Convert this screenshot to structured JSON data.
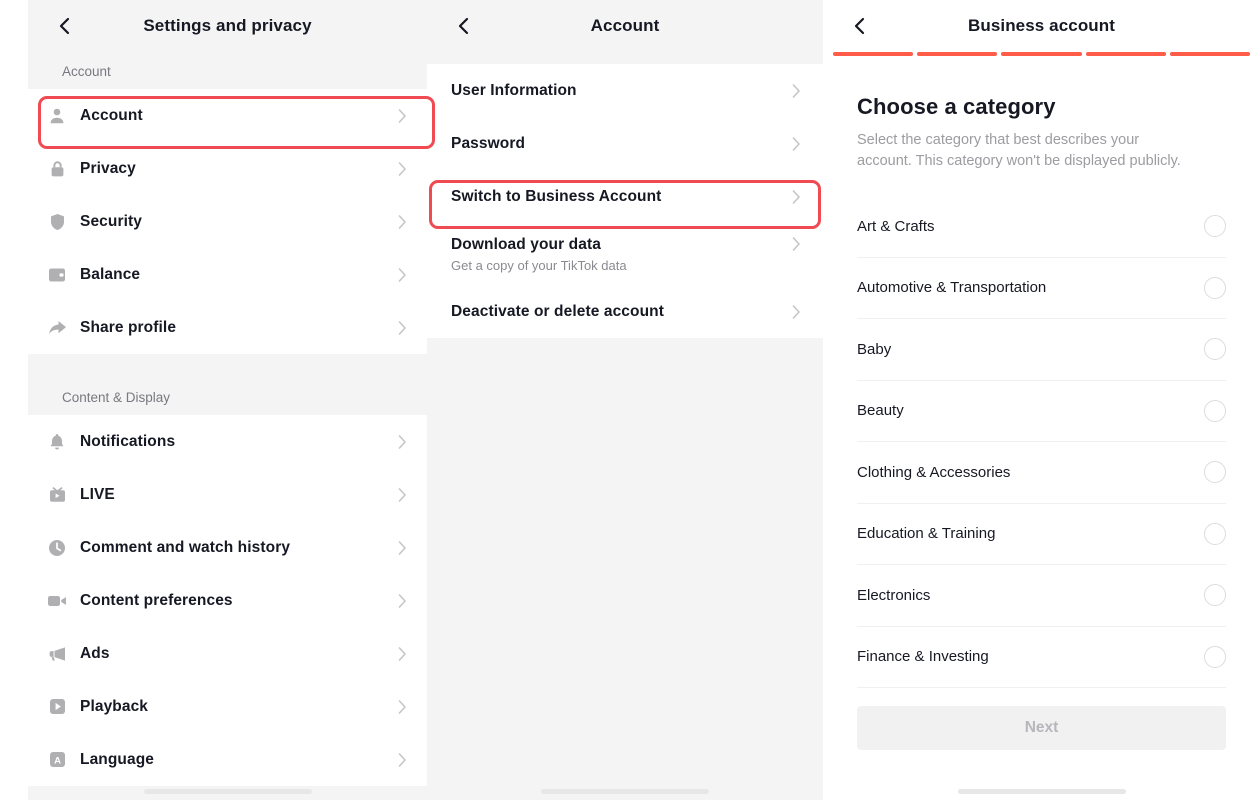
{
  "colors": {
    "accent": "#fe5c49",
    "highlight_ring": "#f04a52",
    "panel_bg": "#f4f4f4",
    "card_bg": "#ffffff",
    "text_primary": "#161823",
    "text_secondary": "#8a8b90"
  },
  "settings_panel": {
    "header": {
      "title": "Settings and privacy",
      "back_icon": "chevron-left-icon"
    },
    "groups": [
      {
        "label": "Account",
        "items": [
          {
            "label": "Account",
            "icon": "person-icon",
            "highlighted": true
          },
          {
            "label": "Privacy",
            "icon": "lock-icon",
            "highlighted": false
          },
          {
            "label": "Security",
            "icon": "shield-icon",
            "highlighted": false
          },
          {
            "label": "Balance",
            "icon": "wallet-icon",
            "highlighted": false
          },
          {
            "label": "Share profile",
            "icon": "share-arrow-icon",
            "highlighted": false
          }
        ]
      },
      {
        "label": "Content & Display",
        "items": [
          {
            "label": "Notifications",
            "icon": "bell-icon",
            "highlighted": false
          },
          {
            "label": "LIVE",
            "icon": "live-tv-icon",
            "highlighted": false
          },
          {
            "label": "Comment and watch history",
            "icon": "clock-icon",
            "highlighted": false
          },
          {
            "label": "Content preferences",
            "icon": "video-camera-icon",
            "highlighted": false
          },
          {
            "label": "Ads",
            "icon": "megaphone-icon",
            "highlighted": false
          },
          {
            "label": "Playback",
            "icon": "play-box-icon",
            "highlighted": false
          },
          {
            "label": "Language",
            "icon": "language-a-icon",
            "highlighted": false
          }
        ]
      }
    ]
  },
  "account_panel": {
    "header": {
      "title": "Account",
      "back_icon": "chevron-left-icon"
    },
    "items": [
      {
        "label": "User Information",
        "sub": null,
        "highlighted": false
      },
      {
        "label": "Password",
        "sub": null,
        "highlighted": false
      },
      {
        "label": "Switch to Business Account",
        "sub": null,
        "highlighted": true
      },
      {
        "label": "Download your data",
        "sub": "Get a copy of your TikTok data",
        "highlighted": false
      },
      {
        "label": "Deactivate or delete account",
        "sub": null,
        "highlighted": false
      }
    ]
  },
  "business_panel": {
    "header": {
      "title": "Business account",
      "back_icon": "chevron-left-icon"
    },
    "progress": {
      "total_steps": 5,
      "completed_steps": 5
    },
    "title": "Choose a category",
    "subtitle": "Select the category that best describes your account. This category won't be displayed publicly.",
    "categories": [
      {
        "label": "Art & Crafts",
        "selected": false
      },
      {
        "label": "Automotive & Transportation",
        "selected": false
      },
      {
        "label": "Baby",
        "selected": false
      },
      {
        "label": "Beauty",
        "selected": false
      },
      {
        "label": "Clothing & Accessories",
        "selected": false
      },
      {
        "label": "Education & Training",
        "selected": false
      },
      {
        "label": "Electronics",
        "selected": false
      },
      {
        "label": "Finance & Investing",
        "selected": false
      }
    ],
    "next_label": "Next",
    "next_enabled": false
  }
}
